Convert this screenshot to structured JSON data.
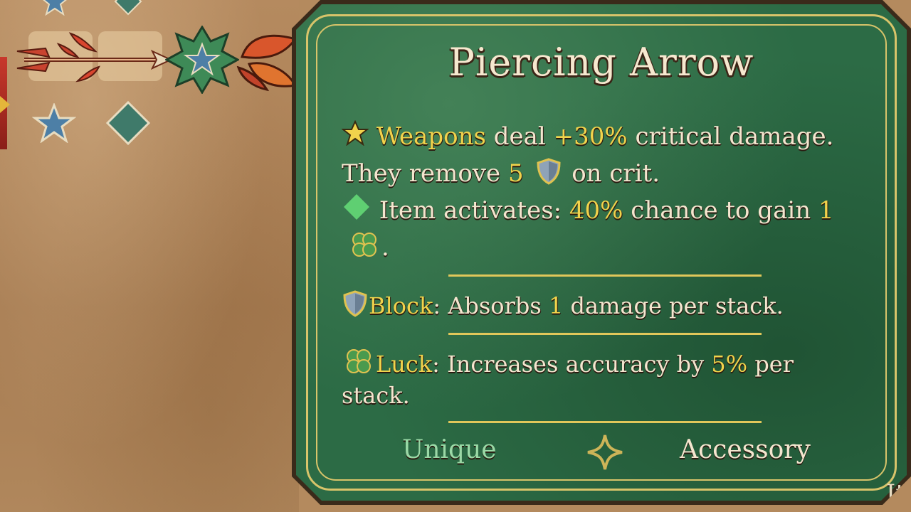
{
  "tooltip": {
    "title": "Piercing Arrow",
    "line1": {
      "keyword": "Weapons",
      "text_a": " deal ",
      "bonus": "+30%",
      "text_b": " critical damage. They remove ",
      "amount": "5",
      "text_c": " on crit."
    },
    "line2": {
      "text_a": "Item activates: ",
      "chance": "40%",
      "text_b": " chance to gain ",
      "amount": "1",
      "text_c": "."
    },
    "block": {
      "name": "Block",
      "text_a": ": Absorbs ",
      "amount": "1",
      "text_b": " damage per stack."
    },
    "luck": {
      "name": "Luck",
      "text_a": ": Increases accuracy by ",
      "amount": "5%",
      "text_b": " per stack."
    },
    "rarity": "Unique",
    "type": "Accessory",
    "corner_text": "It"
  },
  "icons": {
    "star": "star-icon",
    "diamond": "diamond-icon",
    "shield": "shield-icon",
    "clover": "clover-icon",
    "separator": "four-point-star-icon"
  },
  "colors": {
    "gold": "#f1d34c",
    "mint": "#9ad9a6",
    "panel_green": "#2c6b45",
    "text": "#f4e6cf"
  }
}
